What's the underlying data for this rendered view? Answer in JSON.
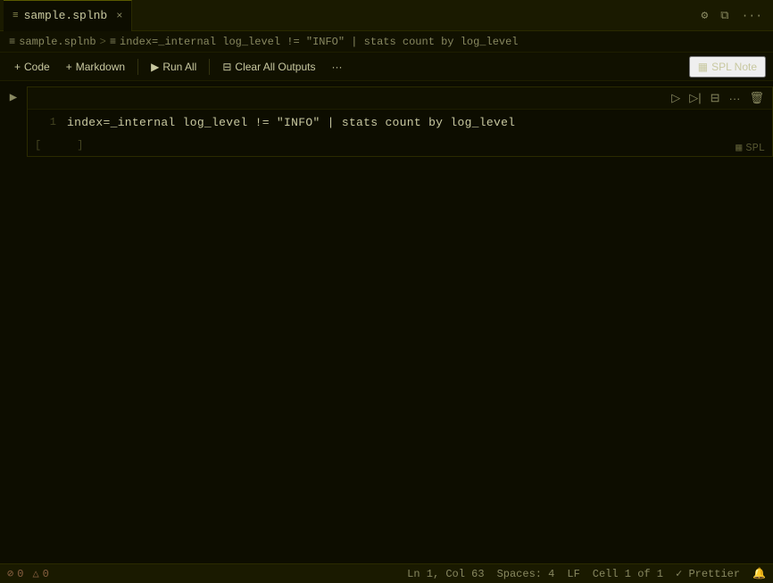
{
  "tab": {
    "icon": "≡",
    "label": "sample.splnb",
    "close": "×"
  },
  "titlebar": {
    "settings_icon": "⚙",
    "split_icon": "⧉",
    "dots_icon": "···"
  },
  "breadcrumb": {
    "icon1": "≡",
    "item1": "sample.splnb",
    "sep1": ">",
    "icon2": "≡",
    "item2": "index=_internal log_level != \"INFO\" | stats count by log_level"
  },
  "toolbar": {
    "add_code_icon": "+",
    "add_code_label": "Code",
    "add_markdown_icon": "+",
    "add_markdown_label": "Markdown",
    "run_all_icon": "▶",
    "run_all_label": "Run All",
    "clear_icon": "⊟",
    "clear_label": "Clear All Outputs",
    "more_icon": "···",
    "spl_note_icon": "▦",
    "spl_note_label": "SPL Note"
  },
  "cell": {
    "run_icon": "▶",
    "actions": {
      "run_icon": "▷",
      "run_next_icon": "▷|",
      "collapse_icon": "⊟",
      "more_icon": "···",
      "trash_icon": "🗑"
    },
    "code": "index=_internal log_level != \"INFO\" | stats count by log_level",
    "spl_icon": "▦",
    "spl_label": "SPL",
    "bracket_open": "[",
    "bracket_close": "]"
  },
  "status": {
    "error_icon": "⊘",
    "error_count": "0",
    "warn_icon": "△",
    "warn_count": "0",
    "ln_col": "Ln 1, Col 63",
    "spaces": "Spaces: 4",
    "eol": "LF",
    "cell_info": "Cell 1 of 1",
    "check_icon": "✓",
    "formatter": "Prettier",
    "bell_icon": "🔔"
  }
}
